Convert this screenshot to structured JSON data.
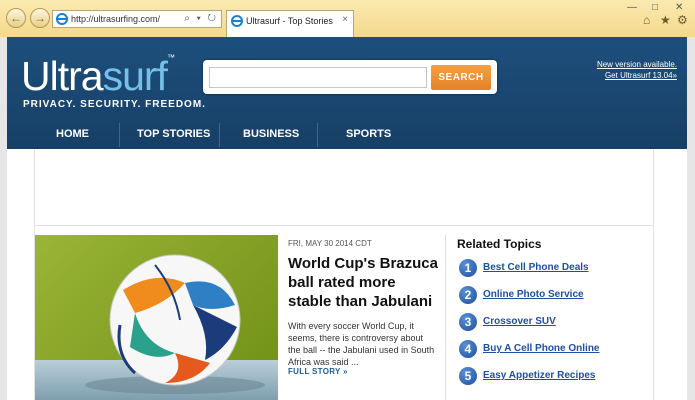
{
  "browser": {
    "address_url": "http://ultrasurfing.com/",
    "address_tools": "⌕ ▾ ↻",
    "tab_title": "Ultrasurf - Top Stories",
    "tab_close": "×",
    "icons": [
      "back-icon",
      "forward-icon",
      "ie-logo-icon",
      "search-icon",
      "refresh-icon",
      "home-icon",
      "favorites-icon",
      "gear-icon",
      "minimize-icon",
      "maximize-icon",
      "close-icon"
    ]
  },
  "header": {
    "logo_main": "Ultra",
    "logo_accent": "surf",
    "logo_tm": "™",
    "tagline": "PRIVACY. SECURITY. FREEDOM.",
    "search_placeholder": "",
    "search_button": "SEARCH",
    "version_line1": "New version available.",
    "version_line2": "Get Ultrasurf 13.04»"
  },
  "menu": [
    "HOME",
    "TOP STORIES",
    "BUSINESS",
    "SPORTS"
  ],
  "article": {
    "date": "FRI, MAY 30 2014 CDT",
    "headline": "World Cup's Brazuca ball rated more stable than Jabulani",
    "summary": "With every soccer World Cup, it seems, there is controversy about the ball -- the Jabulani used in South Africa was said ...",
    "full_story": "FULL STORY »"
  },
  "related": {
    "title": "Related Topics",
    "items": [
      {
        "num": "1",
        "label": "Best Cell Phone Deals"
      },
      {
        "num": "2",
        "label": "Online Photo Service"
      },
      {
        "num": "3",
        "label": "Crossover SUV"
      },
      {
        "num": "4",
        "label": "Buy A Cell Phone Online"
      },
      {
        "num": "5",
        "label": "Easy Appetizer Recipes"
      }
    ]
  },
  "colors": {
    "header_blue": "#1d4f7c",
    "accent_light_blue": "#74c0ea",
    "search_orange": "#e5822a",
    "link_blue": "#1f4fa0"
  }
}
